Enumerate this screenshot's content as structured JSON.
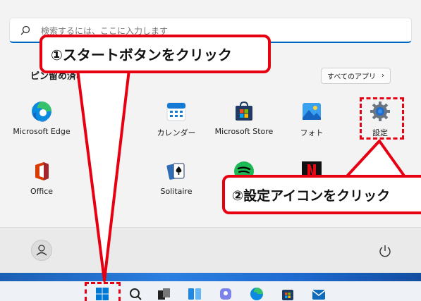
{
  "search": {
    "placeholder": "検索するには、ここに入力します"
  },
  "pinned": {
    "title": "ピン留め済み",
    "all_apps_label": "すべてのアプリ",
    "all_apps_chevron": "›"
  },
  "apps": [
    {
      "name": "edge-app",
      "label": "Microsoft Edge"
    },
    {
      "name": "calendar-app",
      "label": "カレンダー"
    },
    {
      "name": "store-app",
      "label": "Microsoft Store"
    },
    {
      "name": "photos-app",
      "label": "フォト"
    },
    {
      "name": "settings-app",
      "label": "設定"
    },
    {
      "name": "office-app",
      "label": "Office"
    },
    {
      "name": "solitaire-app",
      "label": "Solitaire"
    }
  ],
  "callouts": {
    "start": "①スタートボタンをクリック",
    "settings": "②設定アイコンをクリック"
  },
  "colors": {
    "accent": "#0067c0",
    "annotation_red": "#e60012"
  }
}
